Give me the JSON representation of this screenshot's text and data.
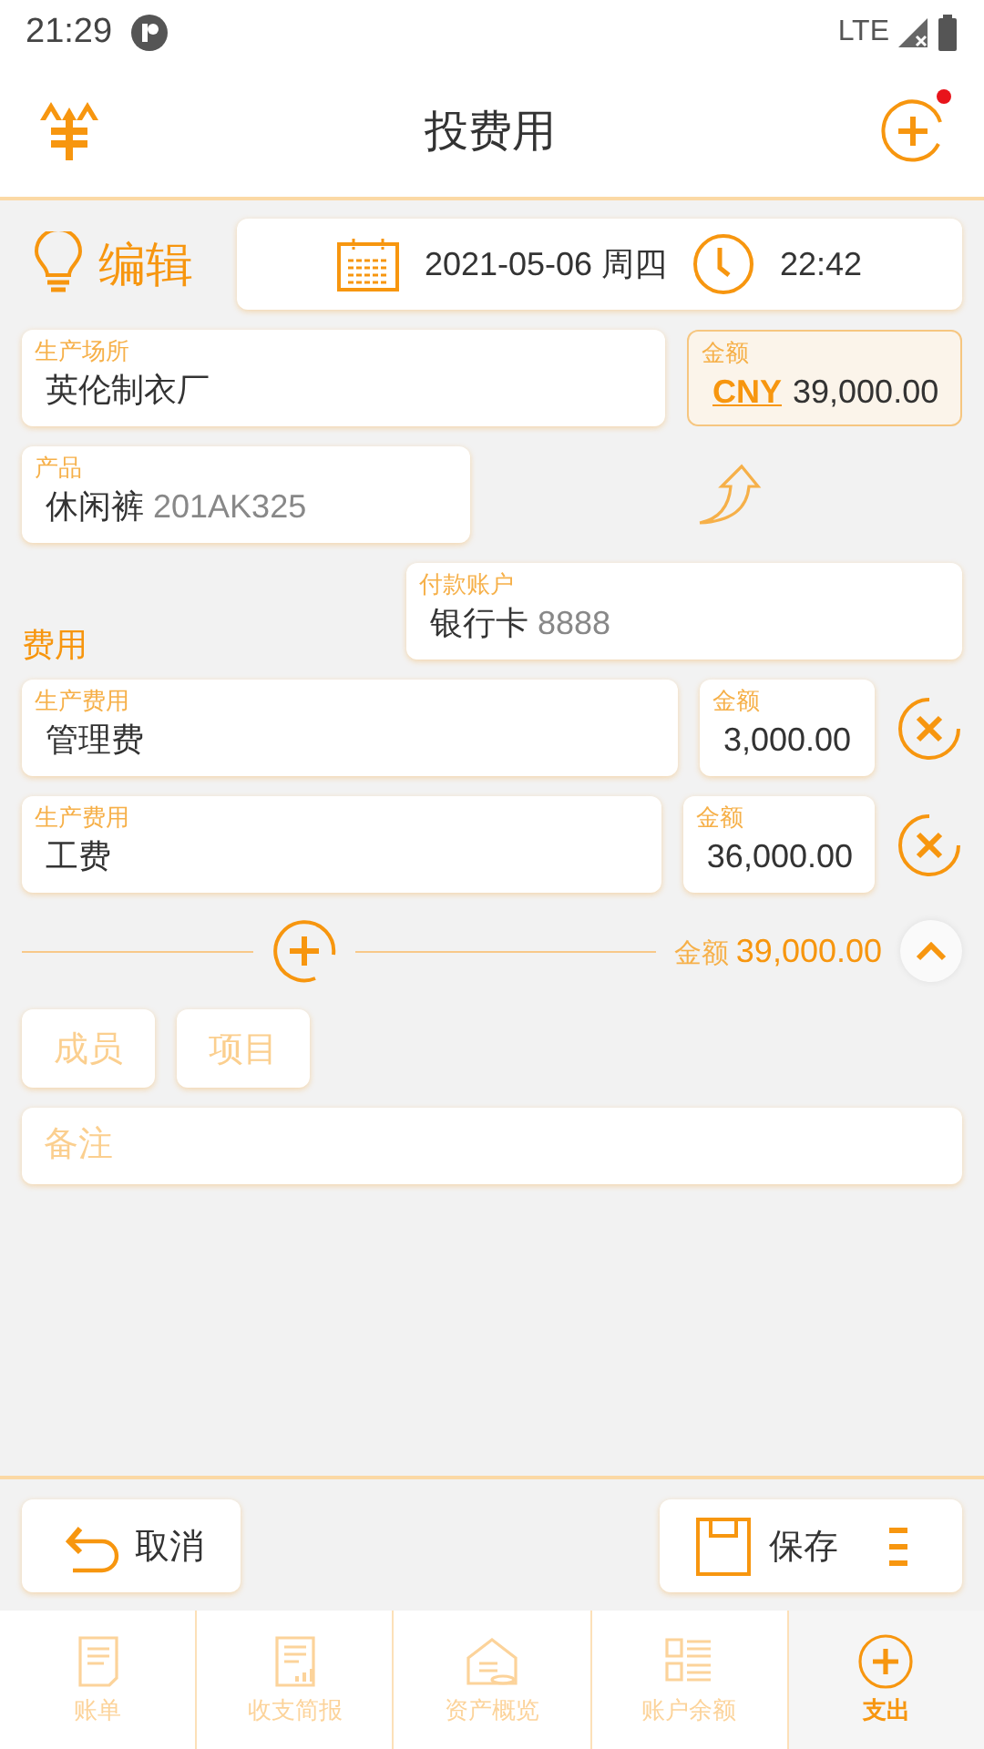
{
  "status_bar": {
    "time": "21:29",
    "network": "LTE"
  },
  "app_bar": {
    "title": "投费用",
    "notification": true
  },
  "mode": {
    "label": "编辑"
  },
  "datetime": {
    "date": "2021-05-06 周四",
    "time": "22:42"
  },
  "place": {
    "label": "生产场所",
    "value": "英伦制衣厂"
  },
  "amount": {
    "label": "金额",
    "currency": "CNY",
    "value": "39,000.00"
  },
  "product": {
    "label": "产品",
    "name": "休闲裤",
    "code": "201AK325"
  },
  "payment_account": {
    "label": "付款账户",
    "name": "银行卡",
    "number": "8888"
  },
  "expenses": {
    "title": "费用",
    "items": [
      {
        "label": "生产费用",
        "value": "管理费",
        "amount_label": "金额",
        "amount": "3,000.00"
      },
      {
        "label": "生产费用",
        "value": "工费",
        "amount_label": "金额",
        "amount": "36,000.00"
      }
    ]
  },
  "total": {
    "label": "金额",
    "value": "39,000.00"
  },
  "chips": [
    {
      "placeholder": "成员"
    },
    {
      "placeholder": "项目"
    }
  ],
  "note": {
    "placeholder": "备注"
  },
  "actions": {
    "cancel": "取消",
    "save": "保存"
  },
  "nav": [
    {
      "label": "账单",
      "selected": false
    },
    {
      "label": "收支简报",
      "selected": false
    },
    {
      "label": "资产概览",
      "selected": false
    },
    {
      "label": "账户余额",
      "selected": false
    },
    {
      "label": "支出",
      "selected": true
    }
  ]
}
